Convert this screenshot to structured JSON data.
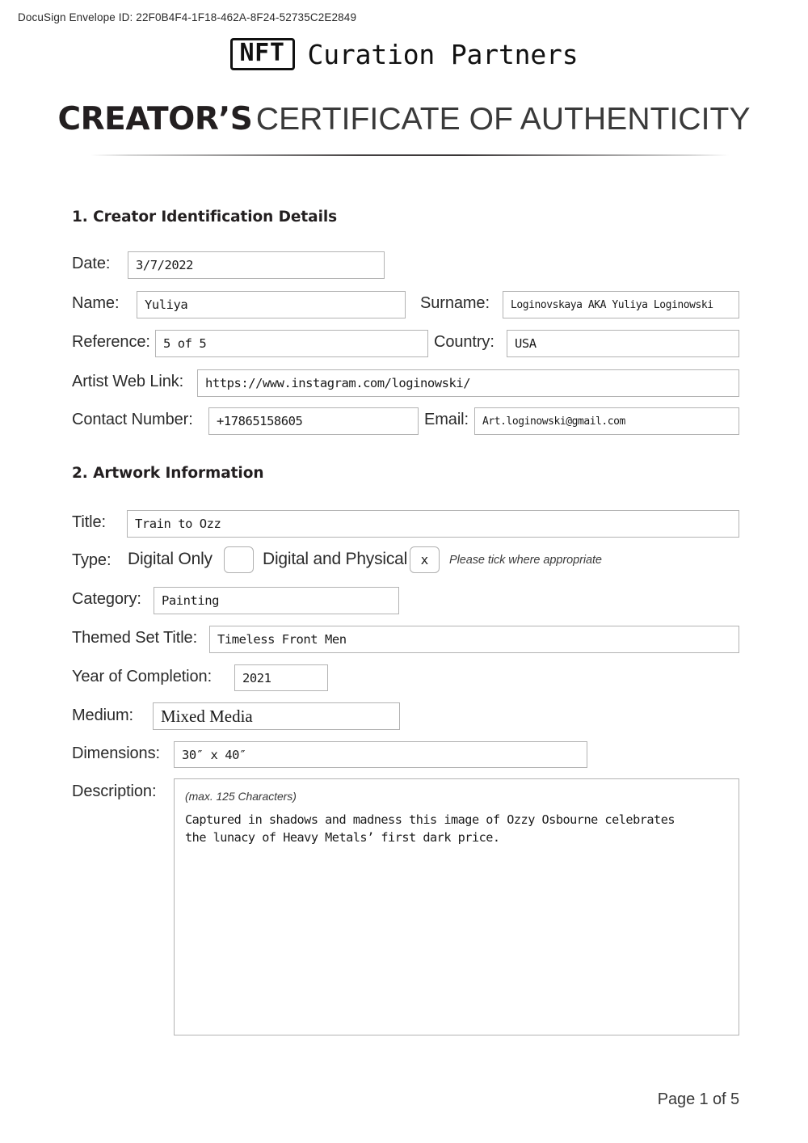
{
  "docusign": {
    "envelope_label": "DocuSign Envelope ID: 22F0B4F4-1F18-462A-8F24-52735C2E2849"
  },
  "brand": {
    "badge": "NFT",
    "name": "Curation Partners"
  },
  "title": {
    "strong": "CREATOR’S",
    "light": "CERTIFICATE OF AUTHENTICITY"
  },
  "sections": {
    "creator": {
      "heading": "1. Creator Identification Details",
      "fields": {
        "date": {
          "label": "Date:",
          "value": "3/7/2022"
        },
        "name": {
          "label": "Name:",
          "value": "Yuliya"
        },
        "surname": {
          "label": "Surname:",
          "value": "Loginovskaya AKA Yuliya Loginowski"
        },
        "reference": {
          "label": "Reference:",
          "value": "5 of 5"
        },
        "country": {
          "label": "Country:",
          "value": "USA"
        },
        "web_link": {
          "label": "Artist Web Link:",
          "value": "https://www.instagram.com/loginowski/"
        },
        "contact_number": {
          "label": "Contact Number:",
          "value": "+17865158605"
        },
        "email": {
          "label": "Email:",
          "value": "Art.loginowski@gmail.com"
        }
      }
    },
    "artwork": {
      "heading": "2. Artwork Information",
      "fields": {
        "title": {
          "label": "Title:",
          "value": "Train to Ozz"
        },
        "type": {
          "label": "Type:",
          "option_digital_only": "Digital Only",
          "option_digital_physical": "Digital and Physical",
          "digital_only_checked": "",
          "digital_physical_checked": "x",
          "note": "Please tick where appropriate"
        },
        "category": {
          "label": "Category:",
          "value": "Painting"
        },
        "themed_set_title": {
          "label": "Themed Set Title:",
          "value": "Timeless Front Men"
        },
        "year_of_completion": {
          "label": "Year of Completion:",
          "value": "2021"
        },
        "medium": {
          "label": "Medium:",
          "value": "Mixed Media"
        },
        "dimensions": {
          "label": "Dimensions:",
          "value": "30″ x 40″"
        },
        "description": {
          "label": "Description:",
          "hint": "(max. 125 Characters)",
          "value": "Captured in shadows and madness this image of Ozzy Osbourne celebrates\nthe lunacy of Heavy Metals’ first dark price."
        }
      }
    }
  },
  "footer": {
    "page_label": "Page 1 of 5"
  }
}
